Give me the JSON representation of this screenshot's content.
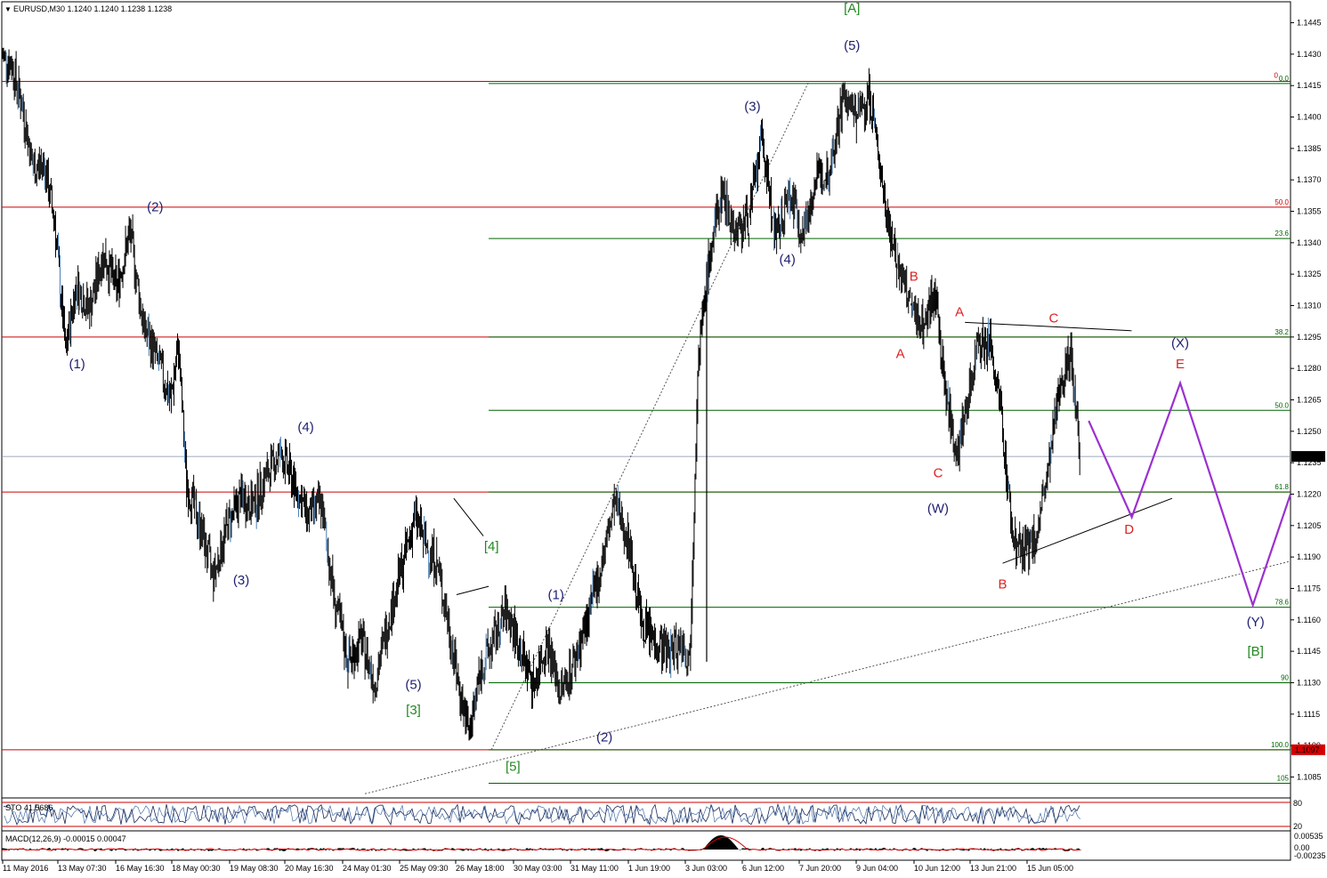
{
  "window": {
    "header": "EURUSD,M30  1.1240 1.1240 1.1238 1.1238",
    "symbol": "EURUSD,M30",
    "ohlc": [
      "1.1240",
      "1.1240",
      "1.1238",
      "1.1238"
    ]
  },
  "colors": {
    "candle": "#000000",
    "hline_red": "#cc0000",
    "fibo_green": "#006400",
    "wave_blue": "#202070",
    "wave_red": "#dd2222",
    "wave_green": "#228822",
    "projection": "#9b30d0",
    "price_tag_bg": "#000000",
    "low_tag_bg": "#d40000"
  },
  "chart_data": [
    {
      "type": "candlestick",
      "symbol": "EURUSD",
      "timeframe": "M30",
      "ylim": [
        1.1075,
        1.1455
      ],
      "y_ticks": [
        "1.1445",
        "1.1430",
        "1.1415",
        "1.1400",
        "1.1385",
        "1.1370",
        "1.1355",
        "1.1340",
        "1.1325",
        "1.1310",
        "1.1295",
        "1.1280",
        "1.1265",
        "1.1250",
        "1.1235",
        "1.1220",
        "1.1205",
        "1.1190",
        "1.1175",
        "1.1160",
        "1.1145",
        "1.1130",
        "1.1115",
        "1.1100",
        "1.1085"
      ],
      "x_ticks": [
        "11 May 2016",
        "13 May 07:30",
        "16 May 16:30",
        "18 May 00:30",
        "19 May 08:30",
        "20 May 16:30",
        "24 May 01:30",
        "25 May 09:30",
        "26 May 18:00",
        "30 May 03:00",
        "31 May 11:00",
        "1 Jun 19:00",
        "3 Jun 03:00",
        "6 Jun 12:00",
        "7 Jun 20:00",
        "9 Jun 04:00",
        "10 Jun 12:00",
        "13 Jun 21:00",
        "15 Jun 05:00"
      ],
      "current_price": "1.1238",
      "low_marker": "1.1097",
      "swing_points": [
        {
          "t": 0.0,
          "p": 1.143
        },
        {
          "t": 0.4,
          "p": 1.1425
        },
        {
          "t": 0.8,
          "p": 1.1405
        },
        {
          "t": 1.2,
          "p": 1.1375
        },
        {
          "t": 1.6,
          "p": 1.1378
        },
        {
          "t": 2.0,
          "p": 1.135
        },
        {
          "t": 2.4,
          "p": 1.1288
        },
        {
          "t": 2.8,
          "p": 1.132
        },
        {
          "t": 3.3,
          "p": 1.1308
        },
        {
          "t": 3.8,
          "p": 1.1335
        },
        {
          "t": 4.3,
          "p": 1.1318
        },
        {
          "t": 4.8,
          "p": 1.1345
        },
        {
          "t": 5.3,
          "p": 1.13
        },
        {
          "t": 5.8,
          "p": 1.1285
        },
        {
          "t": 6.3,
          "p": 1.1265
        },
        {
          "t": 6.6,
          "p": 1.129
        },
        {
          "t": 6.9,
          "p": 1.1225
        },
        {
          "t": 7.4,
          "p": 1.1205
        },
        {
          "t": 7.9,
          "p": 1.118
        },
        {
          "t": 8.4,
          "p": 1.1205
        },
        {
          "t": 8.9,
          "p": 1.1218
        },
        {
          "t": 9.4,
          "p": 1.1215
        },
        {
          "t": 9.9,
          "p": 1.123
        },
        {
          "t": 10.4,
          "p": 1.124
        },
        {
          "t": 10.9,
          "p": 1.1225
        },
        {
          "t": 11.4,
          "p": 1.121
        },
        {
          "t": 11.9,
          "p": 1.1215
        },
        {
          "t": 12.4,
          "p": 1.117
        },
        {
          "t": 12.9,
          "p": 1.114
        },
        {
          "t": 13.4,
          "p": 1.115
        },
        {
          "t": 13.9,
          "p": 1.113
        },
        {
          "t": 14.4,
          "p": 1.116
        },
        {
          "t": 14.9,
          "p": 1.1185
        },
        {
          "t": 15.4,
          "p": 1.121
        },
        {
          "t": 15.8,
          "p": 1.1195
        },
        {
          "t": 16.2,
          "p": 1.1188
        },
        {
          "t": 16.6,
          "p": 1.116
        },
        {
          "t": 17.0,
          "p": 1.113
        },
        {
          "t": 17.4,
          "p": 1.1105
        },
        {
          "t": 17.8,
          "p": 1.1135
        },
        {
          "t": 18.3,
          "p": 1.115
        },
        {
          "t": 18.8,
          "p": 1.1165
        },
        {
          "t": 19.3,
          "p": 1.1145
        },
        {
          "t": 19.8,
          "p": 1.113
        },
        {
          "t": 20.3,
          "p": 1.115
        },
        {
          "t": 20.8,
          "p": 1.1125
        },
        {
          "t": 21.3,
          "p": 1.114
        },
        {
          "t": 21.8,
          "p": 1.116
        },
        {
          "t": 22.3,
          "p": 1.1185
        },
        {
          "t": 22.8,
          "p": 1.1215
        },
        {
          "t": 23.3,
          "p": 1.12
        },
        {
          "t": 23.8,
          "p": 1.116
        },
        {
          "t": 24.3,
          "p": 1.115
        },
        {
          "t": 24.8,
          "p": 1.1145
        },
        {
          "t": 25.3,
          "p": 1.115
        },
        {
          "t": 25.6,
          "p": 1.114
        },
        {
          "t": 25.9,
          "p": 1.128
        },
        {
          "t": 26.3,
          "p": 1.133
        },
        {
          "t": 26.8,
          "p": 1.1365
        },
        {
          "t": 27.3,
          "p": 1.1345
        },
        {
          "t": 27.8,
          "p": 1.1352
        },
        {
          "t": 28.3,
          "p": 1.139
        },
        {
          "t": 28.8,
          "p": 1.134
        },
        {
          "t": 29.3,
          "p": 1.1365
        },
        {
          "t": 29.8,
          "p": 1.1345
        },
        {
          "t": 30.3,
          "p": 1.137
        },
        {
          "t": 30.8,
          "p": 1.1375
        },
        {
          "t": 31.3,
          "p": 1.141
        },
        {
          "t": 31.8,
          "p": 1.14
        },
        {
          "t": 32.3,
          "p": 1.141
        },
        {
          "t": 32.8,
          "p": 1.1365
        },
        {
          "t": 33.3,
          "p": 1.133
        },
        {
          "t": 33.8,
          "p": 1.131
        },
        {
          "t": 34.3,
          "p": 1.13
        },
        {
          "t": 34.7,
          "p": 1.1318
        },
        {
          "t": 35.1,
          "p": 1.127
        },
        {
          "t": 35.5,
          "p": 1.124
        },
        {
          "t": 35.9,
          "p": 1.126
        },
        {
          "t": 36.3,
          "p": 1.1295
        },
        {
          "t": 36.8,
          "p": 1.129
        },
        {
          "t": 37.2,
          "p": 1.1255
        },
        {
          "t": 37.6,
          "p": 1.12
        },
        {
          "t": 38.0,
          "p": 1.1192
        },
        {
          "t": 38.5,
          "p": 1.12
        },
        {
          "t": 39.0,
          "p": 1.1235
        },
        {
          "t": 39.4,
          "p": 1.1278
        },
        {
          "t": 39.8,
          "p": 1.1285
        },
        {
          "t": 40.1,
          "p": 1.124
        }
      ],
      "horizontal_lines_red": [
        1.1417,
        1.1357,
        1.1295,
        1.1221,
        1.1098
      ],
      "current_price_line": 1.1238,
      "fibonacci_levels": [
        {
          "label": "0.0",
          "price": 1.1416
        },
        {
          "label": "23.6",
          "price": 1.1342
        },
        {
          "label": "38.2",
          "price": 1.1295
        },
        {
          "label": "50.0",
          "price": 1.126
        },
        {
          "label": "61.8",
          "price": 1.1221
        },
        {
          "label": "78.6",
          "price": 1.1166
        },
        {
          "label": "90",
          "price": 1.113
        },
        {
          "label": "100.0",
          "price": 1.1098
        },
        {
          "label": "105",
          "price": 1.1082
        }
      ],
      "red_fibo_labels": [
        "0",
        "50.0"
      ],
      "wave_labels": [
        {
          "text": "[A]",
          "color": "green",
          "t": 31.6,
          "p": 1.145
        },
        {
          "text": "(5)",
          "color": "blue",
          "t": 31.6,
          "p": 1.1432
        },
        {
          "text": "(1)",
          "color": "blue",
          "t": 2.8,
          "p": 1.128
        },
        {
          "text": "(2)",
          "color": "blue",
          "t": 5.7,
          "p": 1.1355
        },
        {
          "text": "(3)",
          "color": "blue",
          "t": 8.9,
          "p": 1.1177
        },
        {
          "text": "(4)",
          "color": "blue",
          "t": 11.3,
          "p": 1.125
        },
        {
          "text": "(5)",
          "color": "blue",
          "t": 15.3,
          "p": 1.1127
        },
        {
          "text": "[3]",
          "color": "green",
          "t": 15.3,
          "p": 1.1115
        },
        {
          "text": "[4]",
          "color": "green",
          "t": 18.2,
          "p": 1.1193
        },
        {
          "text": "[5]",
          "color": "green",
          "t": 19.0,
          "p": 1.1088
        },
        {
          "text": "(1)",
          "color": "blue",
          "t": 20.6,
          "p": 1.117
        },
        {
          "text": "(2)",
          "color": "blue",
          "t": 22.4,
          "p": 1.1102
        },
        {
          "text": "(3)",
          "color": "blue",
          "t": 27.9,
          "p": 1.1403
        },
        {
          "text": "(4)",
          "color": "blue",
          "t": 29.2,
          "p": 1.133
        },
        {
          "text": "B",
          "color": "red",
          "t": 33.9,
          "p": 1.1322
        },
        {
          "text": "A",
          "color": "red",
          "t": 33.4,
          "p": 1.1285
        },
        {
          "text": "A",
          "color": "red",
          "t": 35.6,
          "p": 1.1305
        },
        {
          "text": "C",
          "color": "red",
          "t": 34.8,
          "p": 1.1228
        },
        {
          "text": "(W)",
          "color": "blue",
          "t": 34.8,
          "p": 1.1211
        },
        {
          "text": "C",
          "color": "red",
          "t": 39.1,
          "p": 1.1302
        },
        {
          "text": "B",
          "color": "red",
          "t": 37.2,
          "p": 1.1175
        },
        {
          "text": "(X)",
          "color": "blue",
          "t": 43.8,
          "p": 1.129
        },
        {
          "text": "E",
          "color": "red",
          "t": 43.8,
          "p": 1.128
        },
        {
          "text": "D",
          "color": "red",
          "t": 41.9,
          "p": 1.1201
        },
        {
          "text": "(Y)",
          "color": "blue",
          "t": 46.6,
          "p": 1.1157
        },
        {
          "text": "[B]",
          "color": "green",
          "t": 46.6,
          "p": 1.1143
        }
      ],
      "projection_path": [
        {
          "t": 40.4,
          "p": 1.1255
        },
        {
          "t": 42.0,
          "p": 1.1209
        },
        {
          "t": 43.8,
          "p": 1.1273
        },
        {
          "t": 46.5,
          "p": 1.1167
        },
        {
          "t": 47.9,
          "p": 1.122
        }
      ],
      "trendlines": [
        {
          "style": "dotted",
          "from": {
            "t": 13.5,
            "p": 1.1077
          },
          "to": {
            "t": 47.9,
            "p": 1.1188
          }
        },
        {
          "style": "dotted",
          "from": {
            "t": 18.2,
            "p": 1.1098
          },
          "to": {
            "t": 30.0,
            "p": 1.1417
          }
        },
        {
          "style": "solid",
          "from": {
            "t": 35.8,
            "p": 1.1302
          },
          "to": {
            "t": 42.0,
            "p": 1.1298
          }
        },
        {
          "style": "solid",
          "from": {
            "t": 37.2,
            "p": 1.1187
          },
          "to": {
            "t": 43.5,
            "p": 1.1218
          }
        },
        {
          "style": "solid",
          "from": {
            "t": 16.8,
            "p": 1.1218
          },
          "to": {
            "t": 17.9,
            "p": 1.12
          }
        },
        {
          "style": "solid",
          "from": {
            "t": 16.9,
            "p": 1.1172
          },
          "to": {
            "t": 18.1,
            "p": 1.1176
          }
        }
      ],
      "indicators": [
        {
          "name": "STO",
          "label": "STO 41.5686",
          "ylim": [
            0,
            100
          ],
          "levels_right": [
            "80",
            "20"
          ]
        },
        {
          "name": "MACD",
          "label": "MACD(12,26,9) -0.00015 0.00047",
          "y_ticks": [
            "0.00535",
            "0.00",
            "-0.00235"
          ]
        }
      ]
    }
  ]
}
